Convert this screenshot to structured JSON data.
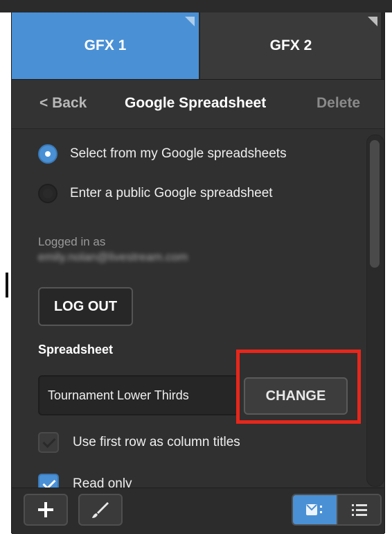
{
  "tabs": [
    {
      "label": "GFX 1",
      "active": true
    },
    {
      "label": "GFX 2",
      "active": false
    }
  ],
  "nav": {
    "back_label": "< Back",
    "title": "Google Spreadsheet",
    "delete_label": "Delete"
  },
  "source_options": [
    {
      "label": "Select from my Google spreadsheets",
      "selected": true
    },
    {
      "label": "Enter a public Google spreadsheet",
      "selected": false
    }
  ],
  "account": {
    "logged_in_label": "Logged in as",
    "email": "emily.nolan@livestream.com",
    "logout_label": "LOG OUT"
  },
  "spreadsheet": {
    "section_label": "Spreadsheet",
    "value": "Tournament Lower Thirds",
    "change_label": "CHANGE"
  },
  "options": [
    {
      "label": "Use first row as column titles",
      "checked": true,
      "enabled": false
    },
    {
      "label": "Read only",
      "checked": true,
      "enabled": true
    }
  ],
  "footer": {
    "icons": [
      "plus-icon",
      "brush-icon",
      "grid-view-icon",
      "list-view-icon"
    ]
  },
  "colors": {
    "accent": "#4a90d5",
    "panel_bg": "#333333",
    "highlight": "#e8261b"
  }
}
